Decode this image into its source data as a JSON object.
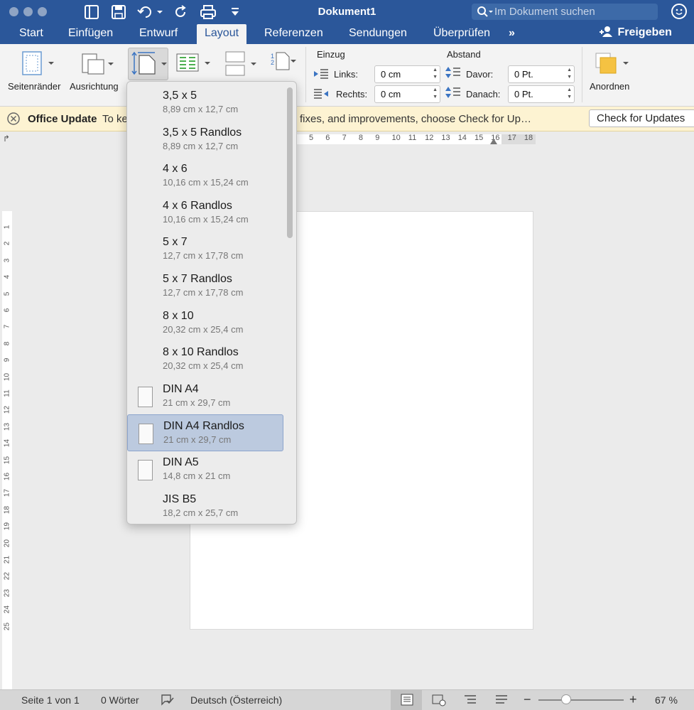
{
  "window": {
    "title": "Dokument1"
  },
  "search": {
    "placeholder": "Im Dokument suchen"
  },
  "tabs": [
    "Start",
    "Einfügen",
    "Entwurf",
    "Layout",
    "Referenzen",
    "Sendungen",
    "Überprüfen"
  ],
  "tabs_more": "»",
  "share_label": "Freigeben",
  "ribbon": {
    "margins_label": "Seitenränder",
    "orientation_label": "Ausrichtung",
    "indent_header": "Einzug",
    "spacing_header": "Abstand",
    "left_label": "Links:",
    "left_value": "0 cm",
    "right_label": "Rechts:",
    "right_value": "0 cm",
    "before_label": "Davor:",
    "before_value": "0 Pt.",
    "after_label": "Danach:",
    "after_value": "0 Pt.",
    "arrange_label": "Anordnen"
  },
  "message_bar": {
    "title": "Office Update",
    "text_start": "To ke",
    "text_end": "fixes, and improvements, choose Check for Up…",
    "button": "Check for Updates"
  },
  "ruler_h": [
    "5",
    "6",
    "7",
    "8",
    "9",
    "10",
    "11",
    "12",
    "13",
    "14",
    "15",
    "16",
    "17",
    "18"
  ],
  "ruler_v": [
    "1",
    "2",
    "3",
    "4",
    "5",
    "6",
    "7",
    "8",
    "9",
    "10",
    "11",
    "12",
    "13",
    "14",
    "15",
    "16",
    "17",
    "18",
    "19",
    "20",
    "21",
    "22",
    "23",
    "24",
    "25"
  ],
  "paper_sizes": [
    {
      "name": "3,5 x 5",
      "size": "8,89 cm x 12,7 cm",
      "icon": false
    },
    {
      "name": "3,5 x 5 Randlos",
      "size": "8,89 cm x 12,7 cm",
      "icon": false
    },
    {
      "name": "4 x 6",
      "size": "10,16 cm x 15,24 cm",
      "icon": false
    },
    {
      "name": "4 x 6 Randlos",
      "size": "10,16 cm x 15,24 cm",
      "icon": false
    },
    {
      "name": "5 x 7",
      "size": "12,7 cm x 17,78 cm",
      "icon": false
    },
    {
      "name": "5 x 7 Randlos",
      "size": "12,7 cm x 17,78 cm",
      "icon": false
    },
    {
      "name": "8 x 10",
      "size": "20,32 cm x 25,4 cm",
      "icon": false
    },
    {
      "name": "8 x 10 Randlos",
      "size": "20,32 cm x 25,4 cm",
      "icon": false
    },
    {
      "name": "DIN A4",
      "size": "21 cm x 29,7 cm",
      "icon": true
    },
    {
      "name": "DIN A4 Randlos",
      "size": "21 cm x 29,7 cm",
      "icon": true,
      "selected": true
    },
    {
      "name": "DIN A5",
      "size": "14,8 cm x 21 cm",
      "icon": true
    },
    {
      "name": "JIS B5",
      "size": "18,2 cm x 25,7 cm",
      "icon": false
    }
  ],
  "status": {
    "page": "Seite 1 von 1",
    "words": "0 Wörter",
    "language": "Deutsch (Österreich)",
    "zoom": "67 %",
    "zoom_minus": "−",
    "zoom_plus": "+"
  },
  "colors": {
    "accent": "#2b579a",
    "selection": "#bccadf",
    "message_bg": "#fdf3d2"
  }
}
